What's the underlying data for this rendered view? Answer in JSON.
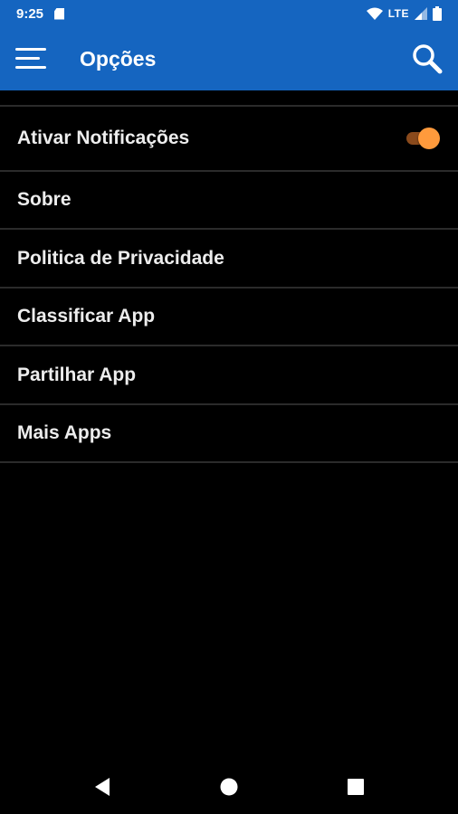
{
  "status_bar": {
    "time": "9:25",
    "network": "LTE",
    "icons": [
      "sd-card-icon",
      "wifi-icon",
      "signal-icon",
      "battery-icon"
    ]
  },
  "app_bar": {
    "title": "Opções",
    "menu_icon": "hamburger-menu-icon",
    "search_icon": "search-icon",
    "background_color": "#1565c0"
  },
  "settings": {
    "items": [
      {
        "label": "Ativar Notificações",
        "toggle": true
      },
      {
        "label": "Sobre"
      },
      {
        "label": "Politica de Privacidade"
      },
      {
        "label": "Classificar App"
      },
      {
        "label": "Partilhar App"
      },
      {
        "label": "Mais Apps"
      }
    ],
    "toggle_color": "#ff9a3c"
  },
  "nav_bar": {
    "buttons": [
      "back-icon",
      "home-icon",
      "recents-icon"
    ]
  }
}
